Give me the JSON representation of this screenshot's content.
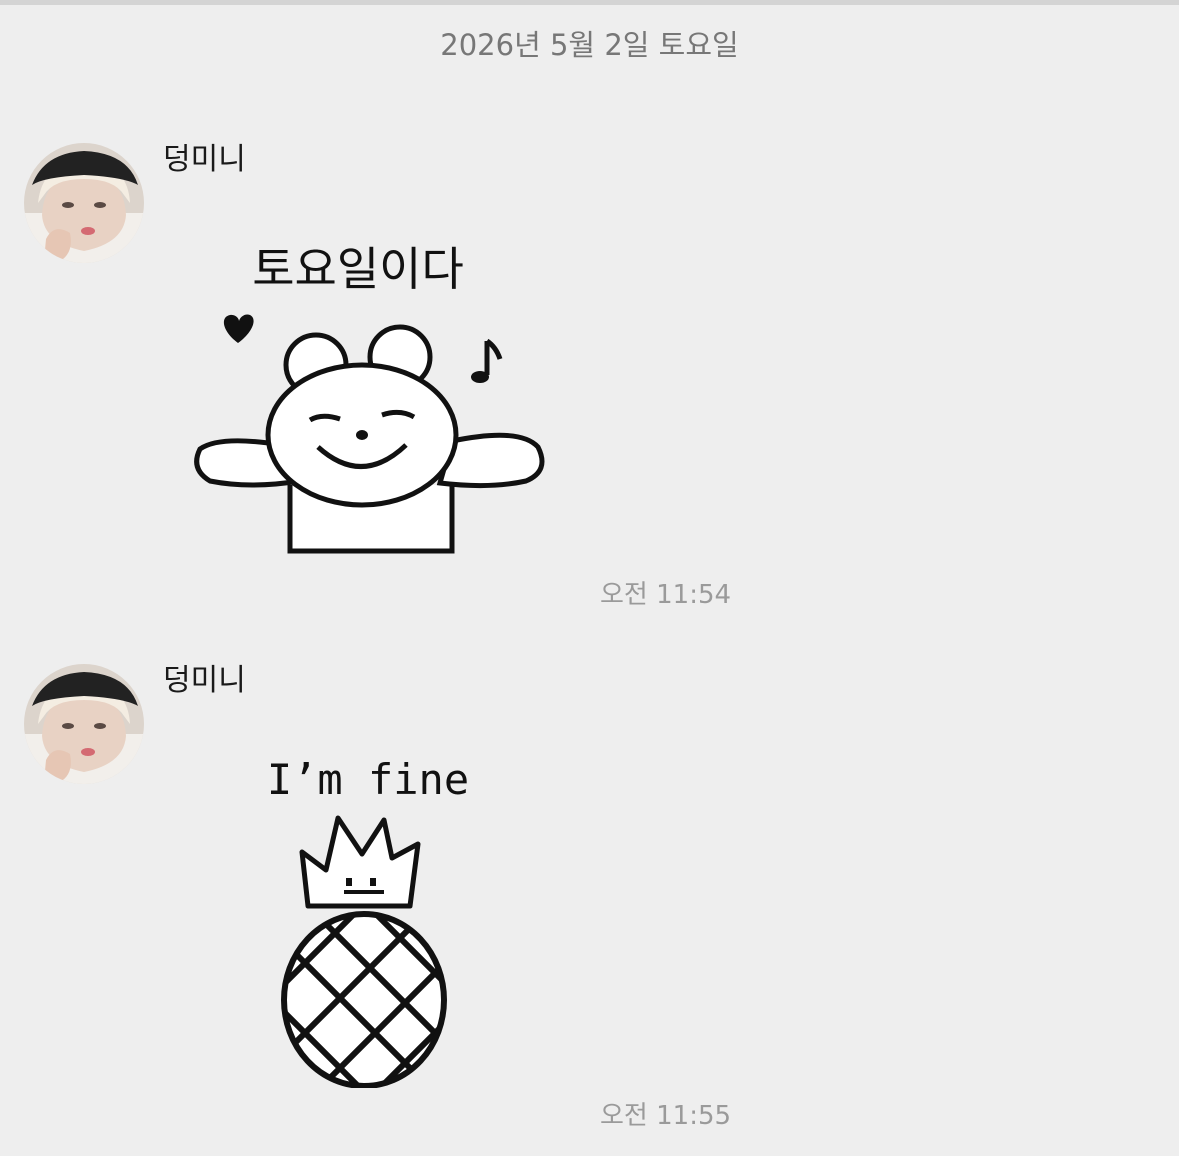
{
  "chat": {
    "date_header": "2026년 5월 2일 토요일",
    "messages": [
      {
        "sender": "덩미니",
        "avatar_icon": "profile-photo-avatar",
        "sticker": {
          "icon": "bear-sticker-icon",
          "caption": "토요일이다"
        },
        "time": "오전 11:54"
      },
      {
        "sender": "덩미니",
        "avatar_icon": "profile-photo-avatar",
        "sticker": {
          "icon": "pineapple-sticker-icon",
          "caption": "I’m fine"
        },
        "time": "오전 11:55"
      }
    ]
  }
}
